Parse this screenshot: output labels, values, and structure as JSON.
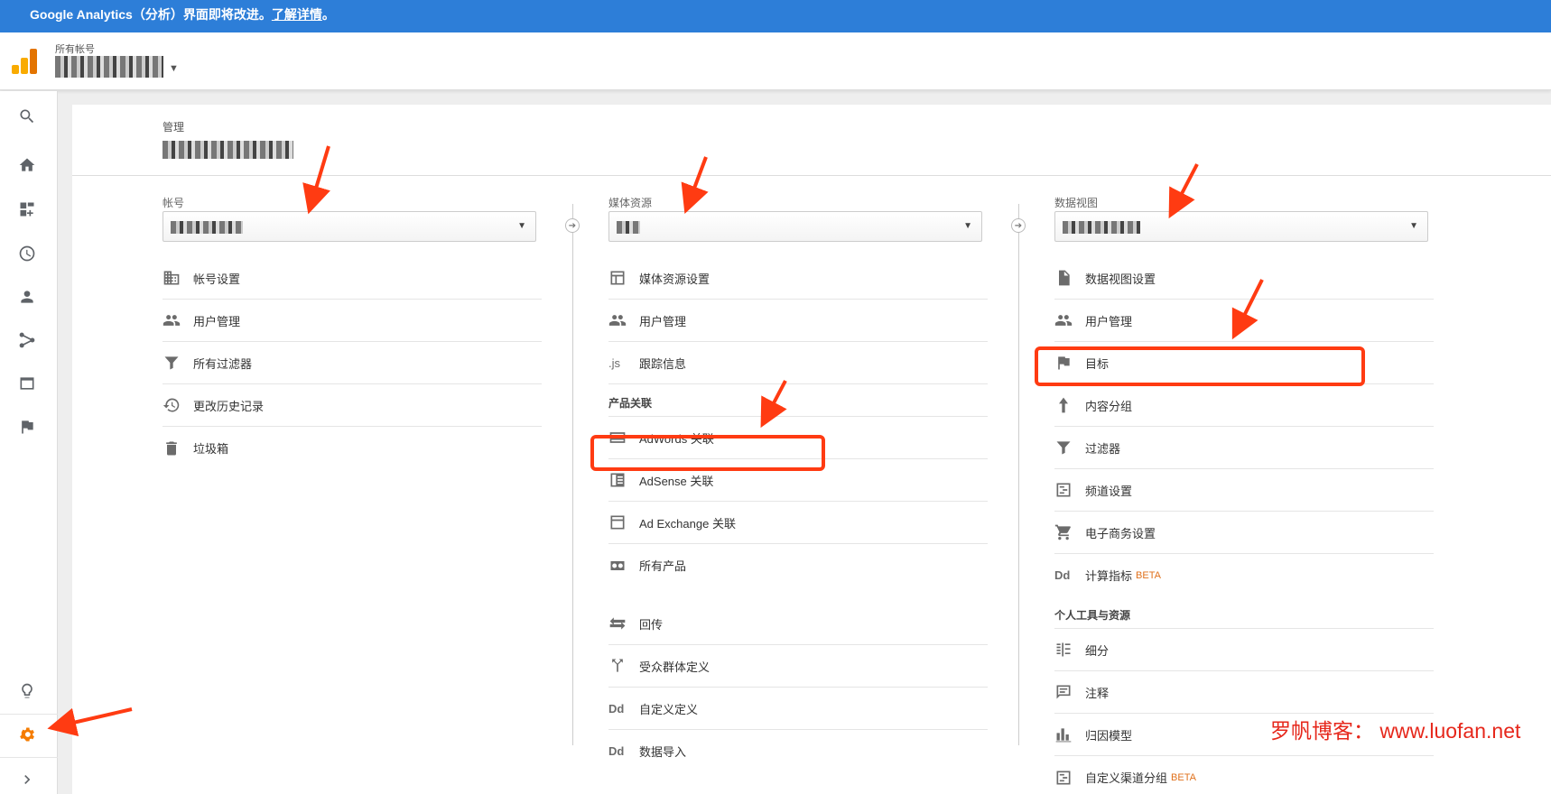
{
  "banner": {
    "text": "Google Analytics（分析）界面即将改进。",
    "link": "了解详情",
    "suffix": "。"
  },
  "header": {
    "account_label": "所有帐号"
  },
  "panel": {
    "admin_label": "管理"
  },
  "columns": {
    "account": {
      "title": "帐号",
      "items": [
        {
          "label": "帐号设置",
          "icon": "building-icon"
        },
        {
          "label": "用户管理",
          "icon": "people-icon"
        },
        {
          "label": "所有过滤器",
          "icon": "filter-icon"
        },
        {
          "label": "更改历史记录",
          "icon": "history-icon"
        },
        {
          "label": "垃圾箱",
          "icon": "trash-icon"
        }
      ]
    },
    "property": {
      "title": "媒体资源",
      "items": [
        {
          "label": "媒体资源设置",
          "icon": "window-icon"
        },
        {
          "label": "用户管理",
          "icon": "people-icon"
        },
        {
          "label": "跟踪信息",
          "icon": ".js"
        }
      ],
      "section": "产品关联",
      "linked": [
        {
          "label": "AdWords 关联",
          "icon": "adwords-icon"
        },
        {
          "label": "AdSense 关联",
          "icon": "adsense-icon"
        },
        {
          "label": "Ad Exchange 关联",
          "icon": "window-icon"
        },
        {
          "label": "所有产品",
          "icon": "link-icon"
        }
      ],
      "more": [
        {
          "label": "回传",
          "icon": "swap-icon"
        },
        {
          "label": "受众群体定义",
          "icon": "fork-icon"
        },
        {
          "label": "自定义定义",
          "icon": "Dd"
        },
        {
          "label": "数据导入",
          "icon": "Dd"
        }
      ]
    },
    "view": {
      "title": "数据视图",
      "items": [
        {
          "label": "数据视图设置",
          "icon": "doc-icon"
        },
        {
          "label": "用户管理",
          "icon": "people-icon"
        },
        {
          "label": "目标",
          "icon": "flag-icon"
        },
        {
          "label": "内容分组",
          "icon": "person-walk-icon"
        },
        {
          "label": "过滤器",
          "icon": "filter-icon"
        },
        {
          "label": "频道设置",
          "icon": "channel-icon"
        },
        {
          "label": "电子商务设置",
          "icon": "cart-icon"
        },
        {
          "label": "计算指标",
          "icon": "Dd",
          "beta": "BETA"
        }
      ],
      "section": "个人工具与资源",
      "tools": [
        {
          "label": "细分",
          "icon": "segment-icon"
        },
        {
          "label": "注释",
          "icon": "comment-icon"
        },
        {
          "label": "归因模型",
          "icon": "bars-icon"
        },
        {
          "label": "自定义渠道分组",
          "icon": "channel-icon",
          "beta": "BETA"
        }
      ]
    }
  },
  "watermark": "罗帆博客：  www.luofan.net",
  "colors": {
    "banner": "#2d7ed8",
    "highlight": "#ff3b12",
    "beta": "#e0711c",
    "gear": "#f57c00"
  }
}
